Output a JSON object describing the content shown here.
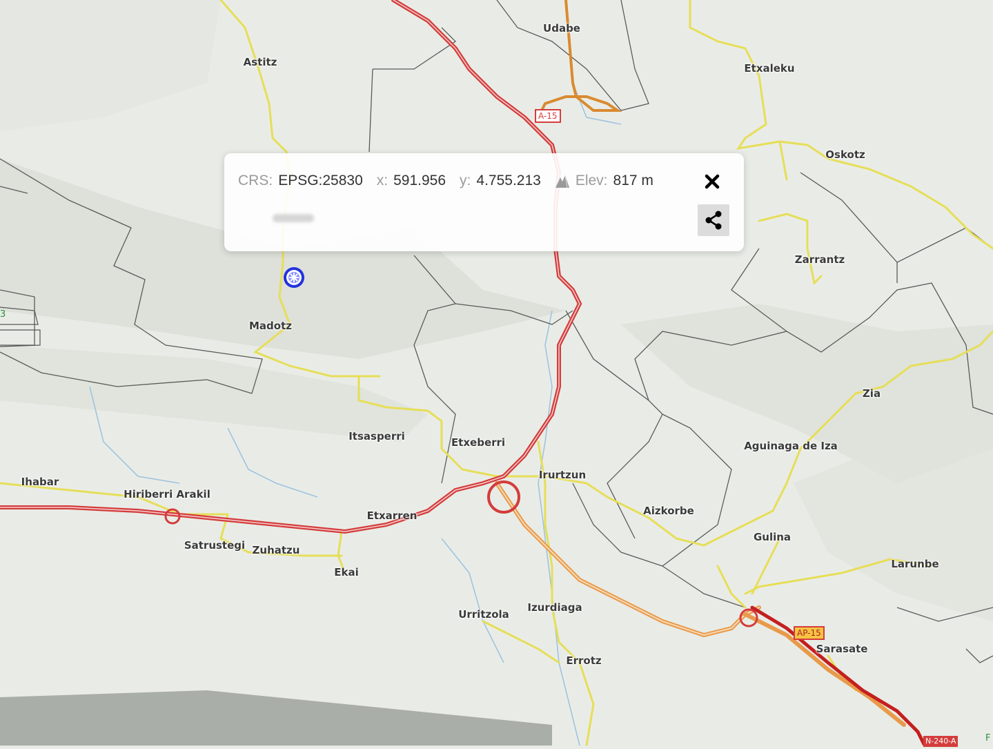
{
  "map": {
    "places": [
      {
        "id": "astitz",
        "name": "Astitz"
      },
      {
        "id": "udabe",
        "name": "Udabe"
      },
      {
        "id": "etxaleku",
        "name": "Etxaleku"
      },
      {
        "id": "oskotz",
        "name": "Oskotz"
      },
      {
        "id": "zarrantz",
        "name": "Zarrantz"
      },
      {
        "id": "madotz",
        "name": "Madotz"
      },
      {
        "id": "itsasperri",
        "name": "Itsasperri"
      },
      {
        "id": "etxeberri",
        "name": "Etxeberri"
      },
      {
        "id": "zia",
        "name": "Zia"
      },
      {
        "id": "aguinaga",
        "name": "Aguinaga de Iza"
      },
      {
        "id": "ihabar",
        "name": "Ihabar"
      },
      {
        "id": "hiriberri",
        "name": "Hiriberri Arakil"
      },
      {
        "id": "irurtzun",
        "name": "Irurtzun"
      },
      {
        "id": "etxarren",
        "name": "Etxarren"
      },
      {
        "id": "aizkorbe",
        "name": "Aizkorbe"
      },
      {
        "id": "gulina",
        "name": "Gulina"
      },
      {
        "id": "satrustegi",
        "name": "Satrustegi"
      },
      {
        "id": "zuhatzu",
        "name": "Zuhatzu"
      },
      {
        "id": "larunbe",
        "name": "Larunbe"
      },
      {
        "id": "ekai",
        "name": "Ekai"
      },
      {
        "id": "urritzola",
        "name": "Urritzola"
      },
      {
        "id": "izurdiaga",
        "name": "Izurdiaga"
      },
      {
        "id": "sarasate",
        "name": "Sarasate"
      },
      {
        "id": "errotz",
        "name": "Errotz"
      }
    ],
    "shields": [
      {
        "id": "a15",
        "label": "A-15"
      },
      {
        "id": "ap15",
        "label": "AP-15"
      },
      {
        "id": "n240",
        "label": "N-240-A"
      }
    ],
    "edge_left": "3",
    "edge_right": "F"
  },
  "popup": {
    "crs_label": "CRS:",
    "crs_value": "EPSG:25830",
    "x_label": "x:",
    "x_value": "591.956",
    "y_label": "y:",
    "y_value": "4.755.213",
    "elev_label": "Elev:",
    "elev_value": "817 m",
    "close_icon": "close-icon",
    "share_icon": "share-icon"
  },
  "colors": {
    "motorway": "#d43c3c",
    "primary_road": "#e89a4a",
    "secondary_road": "#e8e05a",
    "marker": "#2233dd",
    "boundary": "#555555"
  }
}
